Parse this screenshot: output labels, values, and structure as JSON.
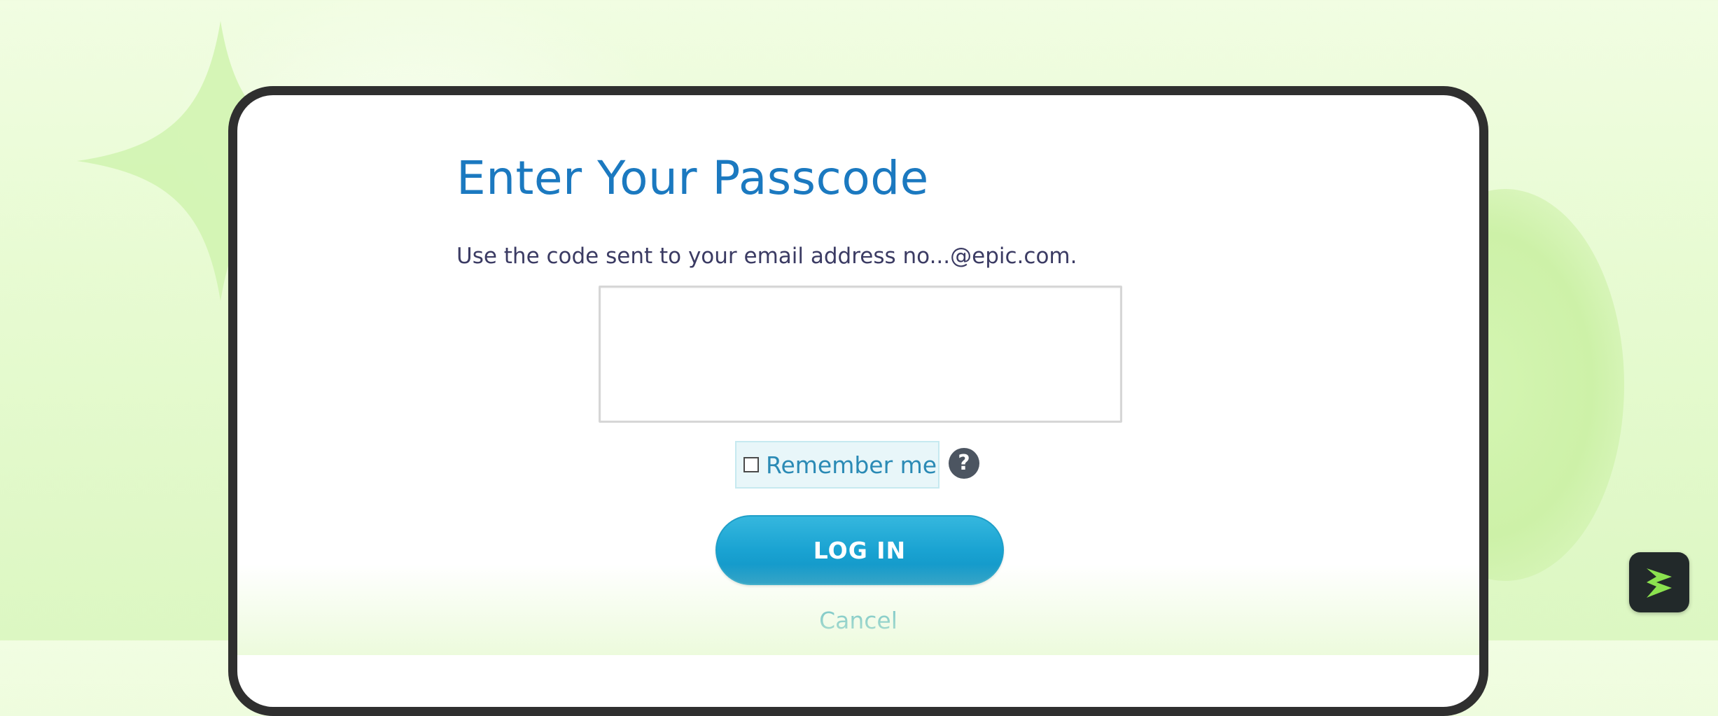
{
  "page": {
    "title": "Enter Your Passcode",
    "instruction": "Use the code sent to your email address no...@epic.com."
  },
  "form": {
    "passcode_value": "",
    "remember_label": "Remember me",
    "remember_checked": false,
    "help_glyph": "?",
    "login_label": "LOG IN",
    "cancel_label": "Cancel"
  },
  "icons": {
    "help": "question-circle-icon",
    "brand": "lightning-logo-icon",
    "decoration": "four-point-sparkle-icon"
  },
  "colors": {
    "title": "#1b79c0",
    "instruction": "#3b3b63",
    "login_button": "#1aa3d2",
    "cancel_link": "#33a6bf",
    "remember_bg": "#e8f6f9",
    "frame": "#2f2f2f",
    "background": "#e8fbd3",
    "brand_green": "#8be24f"
  }
}
